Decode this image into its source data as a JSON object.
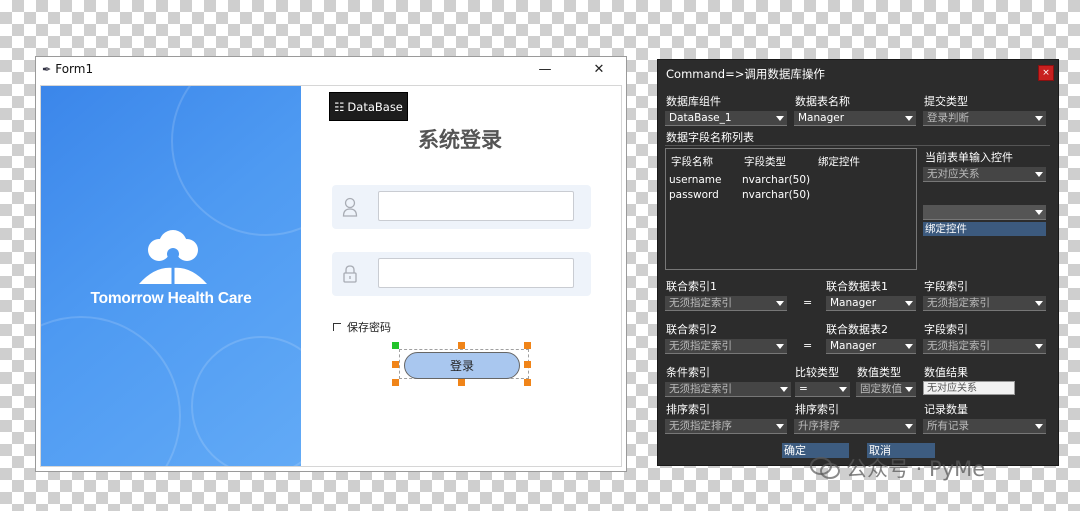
{
  "form1": {
    "title": "Form1",
    "minimize": "—",
    "close": "✕",
    "brand": "Tomorrow Health Care",
    "database_button": "DataBase",
    "system_title": "系统登录",
    "username_value": "",
    "password_value": "",
    "remember_label": "保存密码",
    "login_label": "登录"
  },
  "command": {
    "title": "Command=>调用数据库操作",
    "close": "×",
    "db_component_label": "数据库组件",
    "db_component_value": "DataBase_1",
    "table_name_label": "数据表名称",
    "table_name_value": "Manager",
    "submit_type_label": "提交类型",
    "submit_type_value": "登录判断",
    "field_list_label": "数据字段名称列表",
    "field_headers": [
      "字段名称",
      "字段类型",
      "绑定控件"
    ],
    "fields": [
      {
        "name": "username",
        "type": "nvarchar(50)"
      },
      {
        "name": "password",
        "type": "nvarchar(50)"
      }
    ],
    "current_input_label": "当前表单输入控件",
    "current_input_value": "无对应关系",
    "bind_dropdown_value": "",
    "bind_item_label": "绑定控件",
    "union_index1_label": "联合索引1",
    "union_index1_value": "无须指定索引",
    "eq1": "=",
    "union_table1_label": "联合数据表1",
    "union_table1_value": "Manager",
    "field_index1_label": "字段索引",
    "field_index1_value": "无须指定索引",
    "union_index2_label": "联合索引2",
    "union_index2_value": "无须指定索引",
    "eq2": "=",
    "union_table2_label": "联合数据表2",
    "union_table2_value": "Manager",
    "field_index2_label": "字段索引",
    "field_index2_value": "无须指定索引",
    "cond_index_label": "条件索引",
    "cond_index_value": "无须指定索引",
    "compare_type_label": "比较类型",
    "compare_type_value": "=",
    "value_type_label": "数值类型",
    "value_type_value": "固定数值",
    "value_result_label": "数值结果",
    "value_result_value": "无对应关系",
    "sort_index_label": "排序索引",
    "sort_index_value": "无须指定排序",
    "sort_index2_label": "排序索引",
    "sort_index2_value": "升序排序",
    "record_count_label": "记录数量",
    "record_count_value": "所有记录",
    "ok_label": "确定",
    "cancel_label": "取消"
  },
  "watermark": "公众号 · PyMe",
  "colors": {
    "dialog_bg": "#2c2c2c",
    "panel_blue": "#4e9af2",
    "login_button": "#a9c7ef",
    "handle_orange": "#f08418",
    "handle_green": "#22c32a",
    "close_red": "#c8201f"
  }
}
